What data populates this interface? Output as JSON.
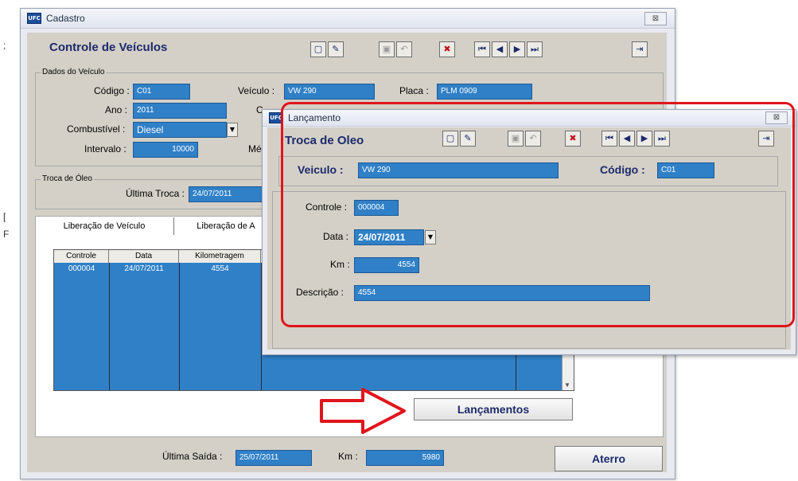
{
  "cadastro": {
    "window_title": "Cadastro",
    "close_label": "⊠",
    "heading": "Controle de Veículos",
    "dados_group": "Dados do Veículo",
    "codigo_label": "Código :",
    "codigo_value": "C01",
    "veiculo_label": "Veículo :",
    "veiculo_value": "VW 290",
    "placa_label": "Placa :",
    "placa_value": "PLM 0909",
    "ano_label": "Ano :",
    "ano_value": "2011",
    "combustivel_label": "Combustível :",
    "combustivel_value": "Diesel",
    "intervalo_label": "Intervalo :",
    "intervalo_value": "10000",
    "hidden_label_c": "C",
    "hidden_label_me": "Mé",
    "troca_group": "Troca de Óleo",
    "ultima_troca_label": "Última Troca :",
    "ultima_troca_value": "24/07/2011",
    "tabs": [
      "Liberação de Veículo",
      "Liberação de A"
    ],
    "grid": {
      "columns": [
        "Controle",
        "Data",
        "Kilometragem"
      ],
      "rows": [
        [
          "000004",
          "24/07/2011",
          "4554"
        ]
      ]
    },
    "lancamentos_button": "Lançamentos",
    "ultima_saida_label": "Última Saída :",
    "ultima_saida_value": "25/07/2011",
    "km_label": "Km :",
    "km_value": "5980",
    "aterro_button": "Aterro"
  },
  "lancamento": {
    "window_title": "Lançamento",
    "close_label": "⊠",
    "heading": "Troca de Oleo",
    "veiculo_label": "Veiculo :",
    "veiculo_value": "VW 290",
    "codigo_label": "Código :",
    "codigo_value": "C01",
    "controle_label": "Controle :",
    "controle_value": "000004",
    "data_label": "Data :",
    "data_value": "24/07/2011",
    "km_label": "Km :",
    "km_value": "4554",
    "descricao_label": "Descrição :",
    "descricao_value": "4554"
  },
  "toolbar_icons": [
    "new-icon",
    "edit-icon",
    "save-icon",
    "undo-icon",
    "delete-icon",
    "first-icon",
    "prev-icon",
    "next-icon",
    "last-icon",
    "exit-icon"
  ],
  "colors": {
    "field_blue": "#2f80c7",
    "heading_navy": "#1c2a6b",
    "highlight_red": "#e0151b"
  }
}
